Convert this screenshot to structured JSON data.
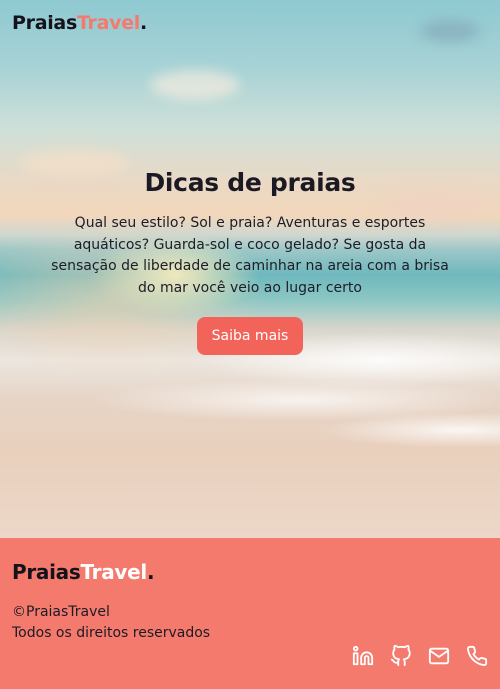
{
  "header": {
    "brand_part1": "Praias",
    "brand_part2": "Travel",
    "brand_dot": "."
  },
  "hero": {
    "title": "Dicas de praias",
    "text": "Qual seu estilo? Sol e praia? Aventuras e esportes aquáticos? Guarda-sol e coco gelado? Se gosta da sensação de liberdade de caminhar na areia com a brisa do mar você veio ao lugar certo",
    "cta_label": "Saiba mais"
  },
  "footer": {
    "brand_part1": "Praias",
    "brand_part2": "Travel",
    "brand_dot": ".",
    "copyright": "©PraiasTravel",
    "rights": "Todos os direitos reservados",
    "social_icons": [
      "linkedin-icon",
      "github-icon",
      "mail-icon",
      "phone-icon"
    ]
  },
  "colors": {
    "accent": "#f47a6e",
    "cta": "#f2645a",
    "dark": "#14131c"
  }
}
